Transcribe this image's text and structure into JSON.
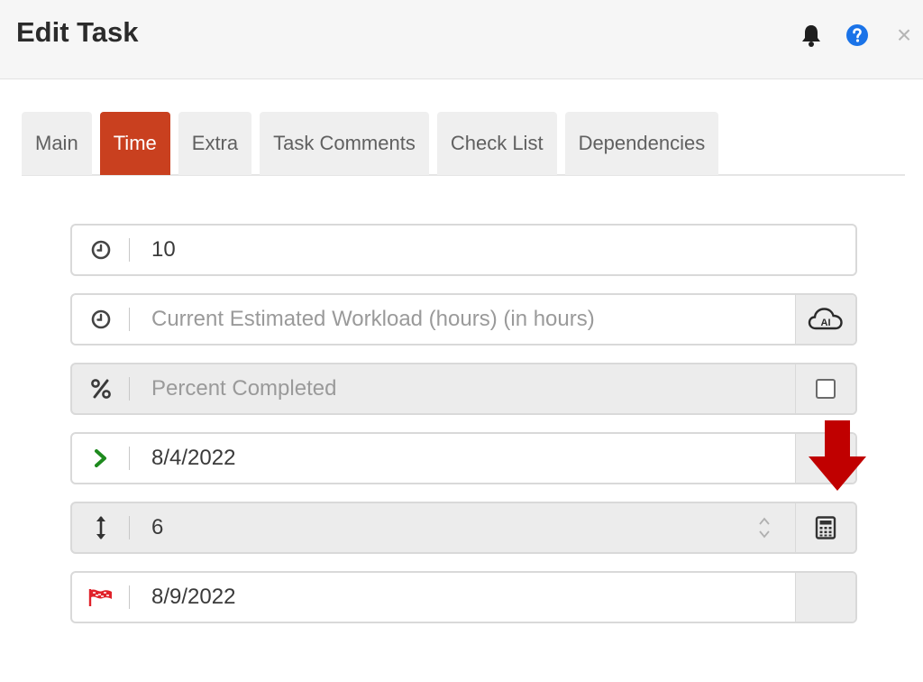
{
  "dialog": {
    "title": "Edit Task"
  },
  "header_icons": [
    "bell-icon",
    "help-icon",
    "close-icon"
  ],
  "close_glyph": "×",
  "tabs": [
    {
      "label": "Main",
      "active": false
    },
    {
      "label": "Time",
      "active": true
    },
    {
      "label": "Extra",
      "active": false
    },
    {
      "label": "Task Comments",
      "active": false
    },
    {
      "label": "Check List",
      "active": false
    },
    {
      "label": "Dependencies",
      "active": false
    }
  ],
  "fields": {
    "estimated_workload": {
      "value": "10",
      "icon": "clock-icon"
    },
    "current_estimated_workload": {
      "value": "",
      "placeholder": "Current Estimated Workload (hours) (in hours)",
      "icon": "clock-icon",
      "action_icon": "ai-cloud-icon"
    },
    "percent_completed": {
      "value": "",
      "placeholder": "Percent Completed",
      "icon": "percent-icon",
      "checked": false
    },
    "start_date": {
      "value": "8/4/2022",
      "icon": "chevron-right-icon"
    },
    "duration": {
      "value": "6",
      "icon": "vertical-arrows-icon",
      "action_icon": "calculator-icon"
    },
    "end_date": {
      "value": "8/9/2022",
      "icon": "flag-icon"
    }
  },
  "colors": {
    "accent": "#c9401f",
    "annotation_arrow": "#c00000",
    "start_icon": "#1e8a1e",
    "flag_icon": "#e0222a",
    "help_icon": "#1a73e8"
  }
}
